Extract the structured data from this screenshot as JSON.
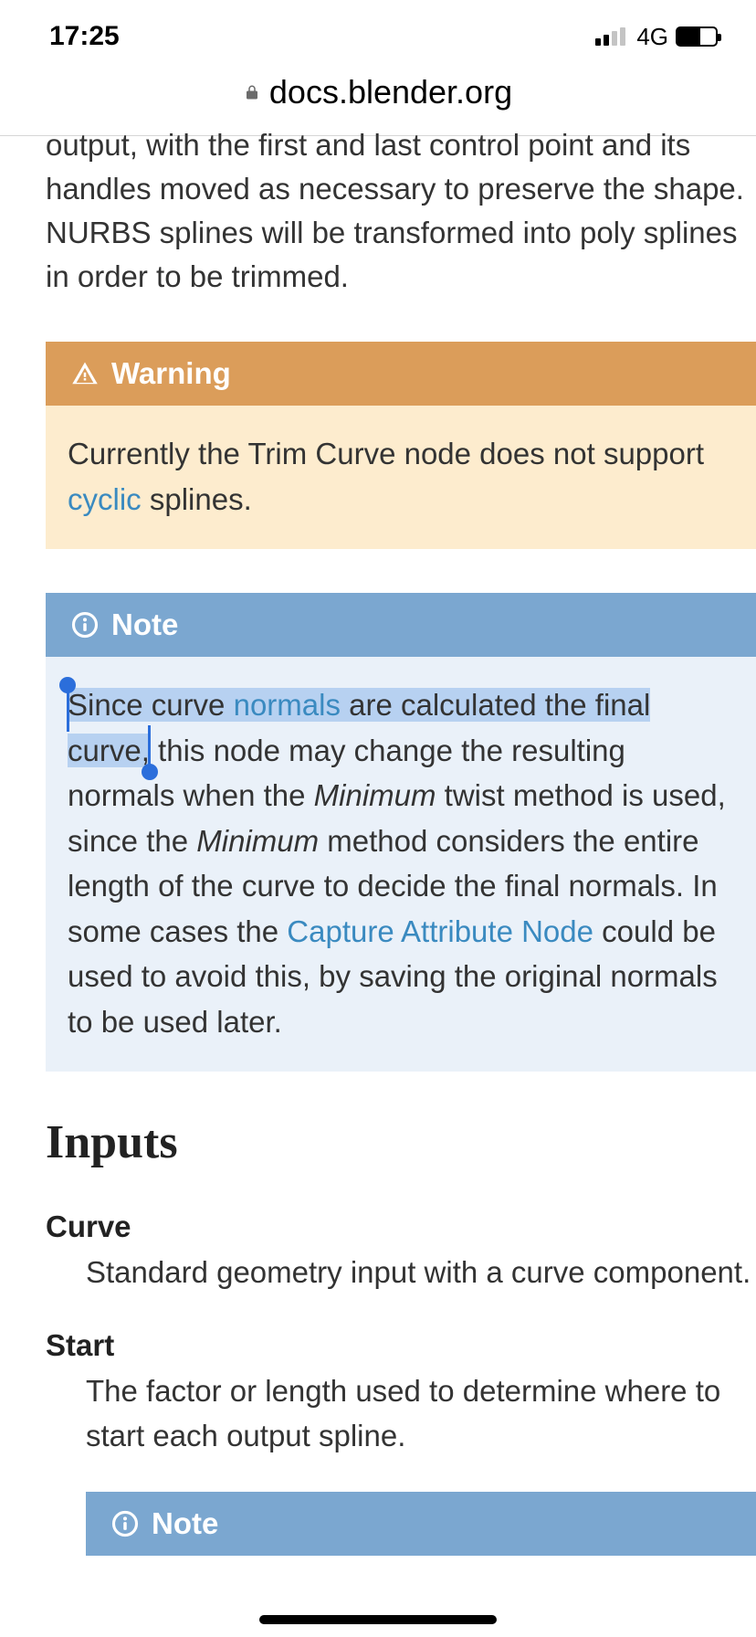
{
  "statusbar": {
    "time": "17:25",
    "network": "4G"
  },
  "url": "docs.blender.org",
  "intro": "output, with the first and last control point and its handles moved as necessary to preserve the shape. NURBS splines will be transformed into poly splines in order to be trimmed.",
  "warning": {
    "title": "Warning",
    "pre": "Currently the Trim Curve node does not support ",
    "link": "cyclic",
    "post": " splines."
  },
  "note": {
    "title": "Note",
    "sel1": "Since curve ",
    "sel_link": "normals",
    "sel2": " are calculated the final curve,",
    "after_sel": " this node may change the resulting normals when the ",
    "em1": "Minimum",
    "mid": " twist method is used, since the ",
    "em2": "Minimum",
    "mid2": " method considers the entire length of the curve to decide the final normals. In some cases the ",
    "link2": "Capture Attribute Node",
    "tail": " could be used to avoid this, by saving the original normals to be used later."
  },
  "inputs": {
    "heading": "Inputs",
    "curve": {
      "term": "Curve",
      "def": "Standard geometry input with a curve component."
    },
    "start": {
      "term": "Start",
      "def": "The factor or length used to determine where to start each output spline."
    },
    "note_title": "Note"
  }
}
